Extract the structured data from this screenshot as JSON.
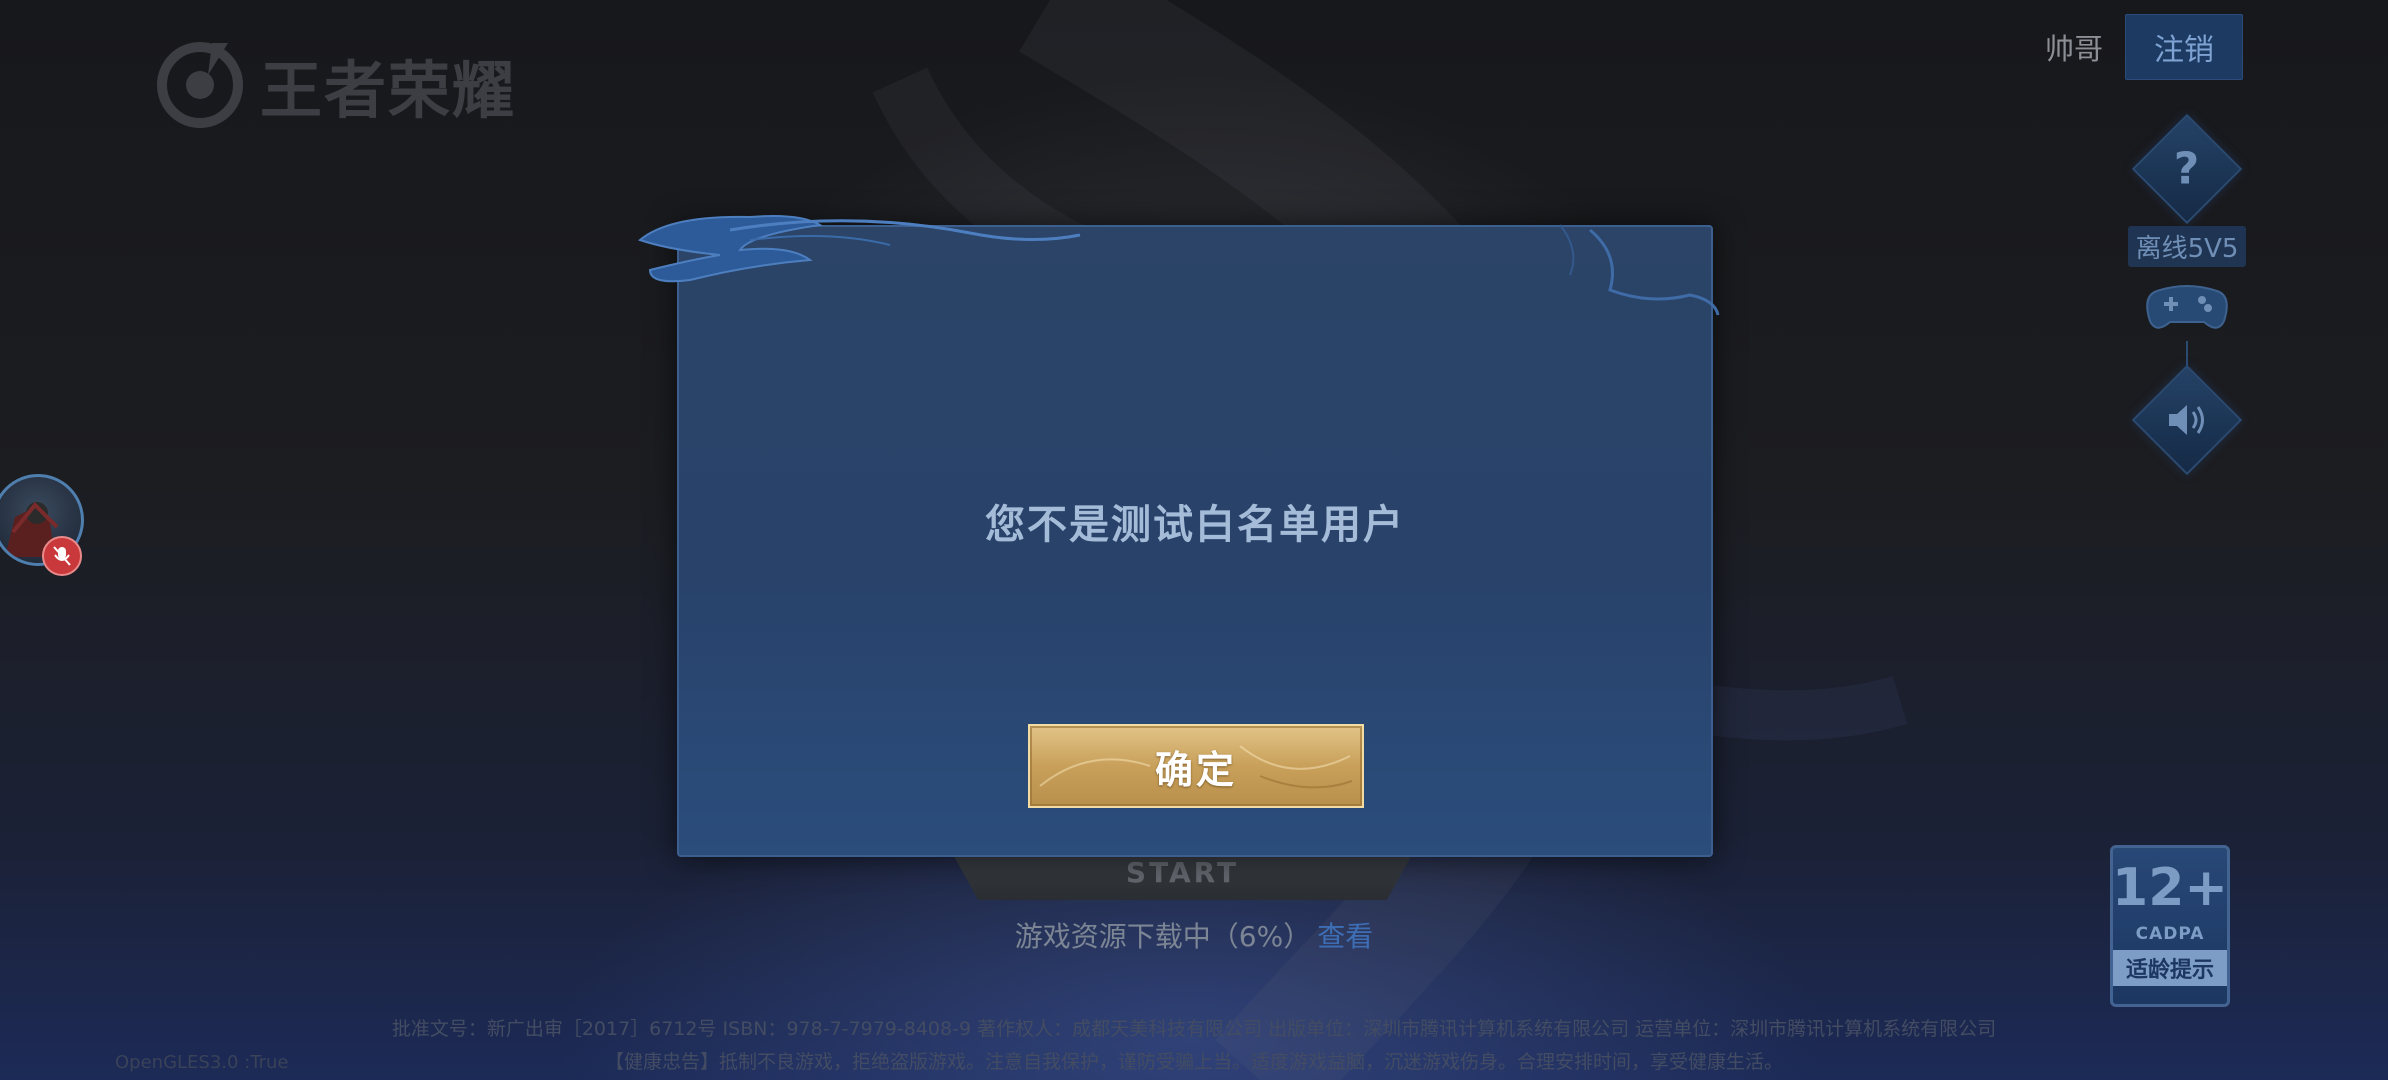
{
  "logo": {
    "text": "王者荣耀"
  },
  "account": {
    "username": "帅哥",
    "logout_label": "注销"
  },
  "side_menu": {
    "help_symbol": "?",
    "offline_mode_label": "离线5V5",
    "icons": [
      "help-icon",
      "gamepad-icon",
      "speaker-icon"
    ]
  },
  "start_button": {
    "label": "START"
  },
  "download": {
    "status_text": "游戏资源下载中（6%）",
    "view_link": "查看"
  },
  "footer": {
    "line1": "批准文号：新广出审［2017］6712号  ISBN：978-7-7979-8408-9  著作权人：成都天美科技有限公司  出版单位：深圳市腾讯计算机系统有限公司  运营单位：深圳市腾讯计算机系统有限公司",
    "line2": "【健康忠告】抵制不良游戏，拒绝盗版游戏。注意自我保护，谨防受骗上当。适度游戏益脑，沉迷游戏伤身。合理安排时间，享受健康生活。",
    "opengl_text": "OpenGLES3.0 :True"
  },
  "age_rating": {
    "age": "12+",
    "org": "CADPA",
    "tip": "适龄提示"
  },
  "dialog": {
    "message": "您不是测试白名单用户",
    "confirm_label": "确定"
  },
  "colors": {
    "dialog_bg": "#2b4468",
    "dialog_border": "#3d5f8f",
    "confirm_gold": "#c8a05a",
    "accent_blue": "#3d6eb5",
    "mic_off_red": "#c9383a"
  }
}
